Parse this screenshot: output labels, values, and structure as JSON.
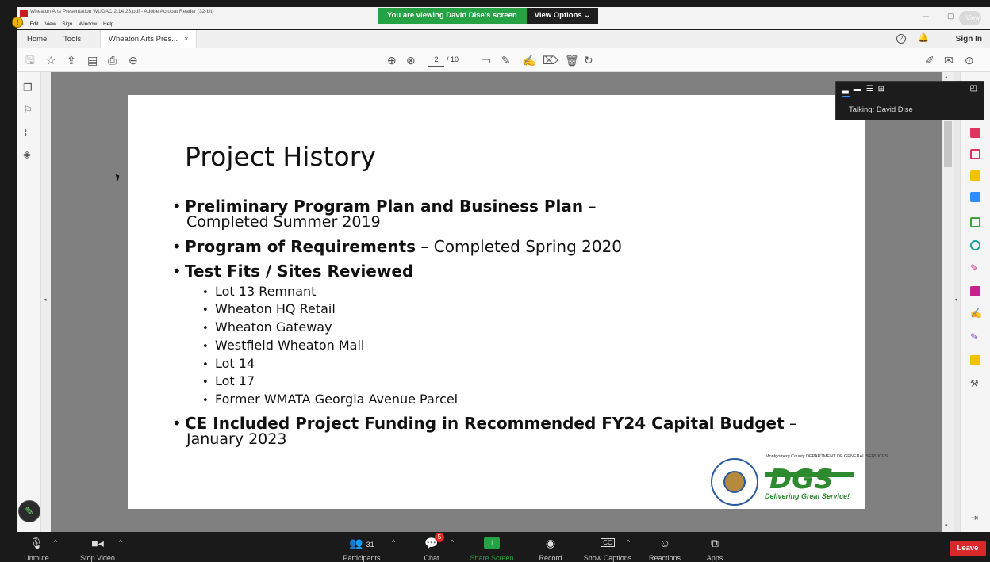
{
  "window": {
    "title": "Wheaton Arts Presentation WUDAC 2.14.23.pdf - Adobe Acrobat Reader (32-bit)",
    "menu": [
      "e",
      "Edit",
      "View",
      "Sign",
      "Window",
      "Help"
    ]
  },
  "share_banner": {
    "message": "You are viewing David Dise's screen",
    "options_label": "View Options",
    "view_button": "View"
  },
  "tabs": {
    "home": "Home",
    "tools": "Tools",
    "doc_tab": "Wheaton Arts Pres...",
    "close": "×",
    "sign_in": "Sign In"
  },
  "toolbar": {
    "page_current": "2",
    "page_total": "/ 10"
  },
  "slide": {
    "title": "Project History",
    "bullets": [
      {
        "bold": "Preliminary Program Plan and Business Plan",
        "rest": " –",
        "line2": "Completed Summer 2019"
      },
      {
        "bold": "Program of Requirements",
        "rest": " – Completed Spring 2020"
      },
      {
        "bold": "Test Fits / Sites Reviewed",
        "rest": ""
      },
      {
        "bold": "CE Included Project Funding in Recommended FY24 Capital Budget",
        "rest": " –",
        "line2": "January 2023"
      }
    ],
    "sites": [
      "Lot 13 Remnant",
      "Wheaton HQ Retail",
      "Wheaton Gateway",
      "Westfield Wheaton Mall",
      "Lot 14",
      "Lot 17",
      "Former WMATA Georgia Avenue Parcel"
    ],
    "logo": {
      "dept": "Montgomery County DEPARTMENT OF GENERAL SERVICES",
      "letters": "DGS",
      "tagline": "Delivering Great Service!"
    }
  },
  "zoom_window": {
    "talking": "Talking: David Dise"
  },
  "zoom_bar": {
    "unmute": "Unmute",
    "stop_video": "Stop Video",
    "participants": "Participants",
    "participants_count": "31",
    "chat": "Chat",
    "chat_badge": "5",
    "share_screen": "Share Screen",
    "record": "Record",
    "show_captions": "Show Captions",
    "captions_icon": "CC",
    "reactions": "Reactions",
    "apps": "Apps",
    "leave": "Leave"
  },
  "colors": {
    "zoom_green": "#25a244",
    "leave_red": "#d8282a",
    "acrobat_red": "#c81e1e"
  }
}
